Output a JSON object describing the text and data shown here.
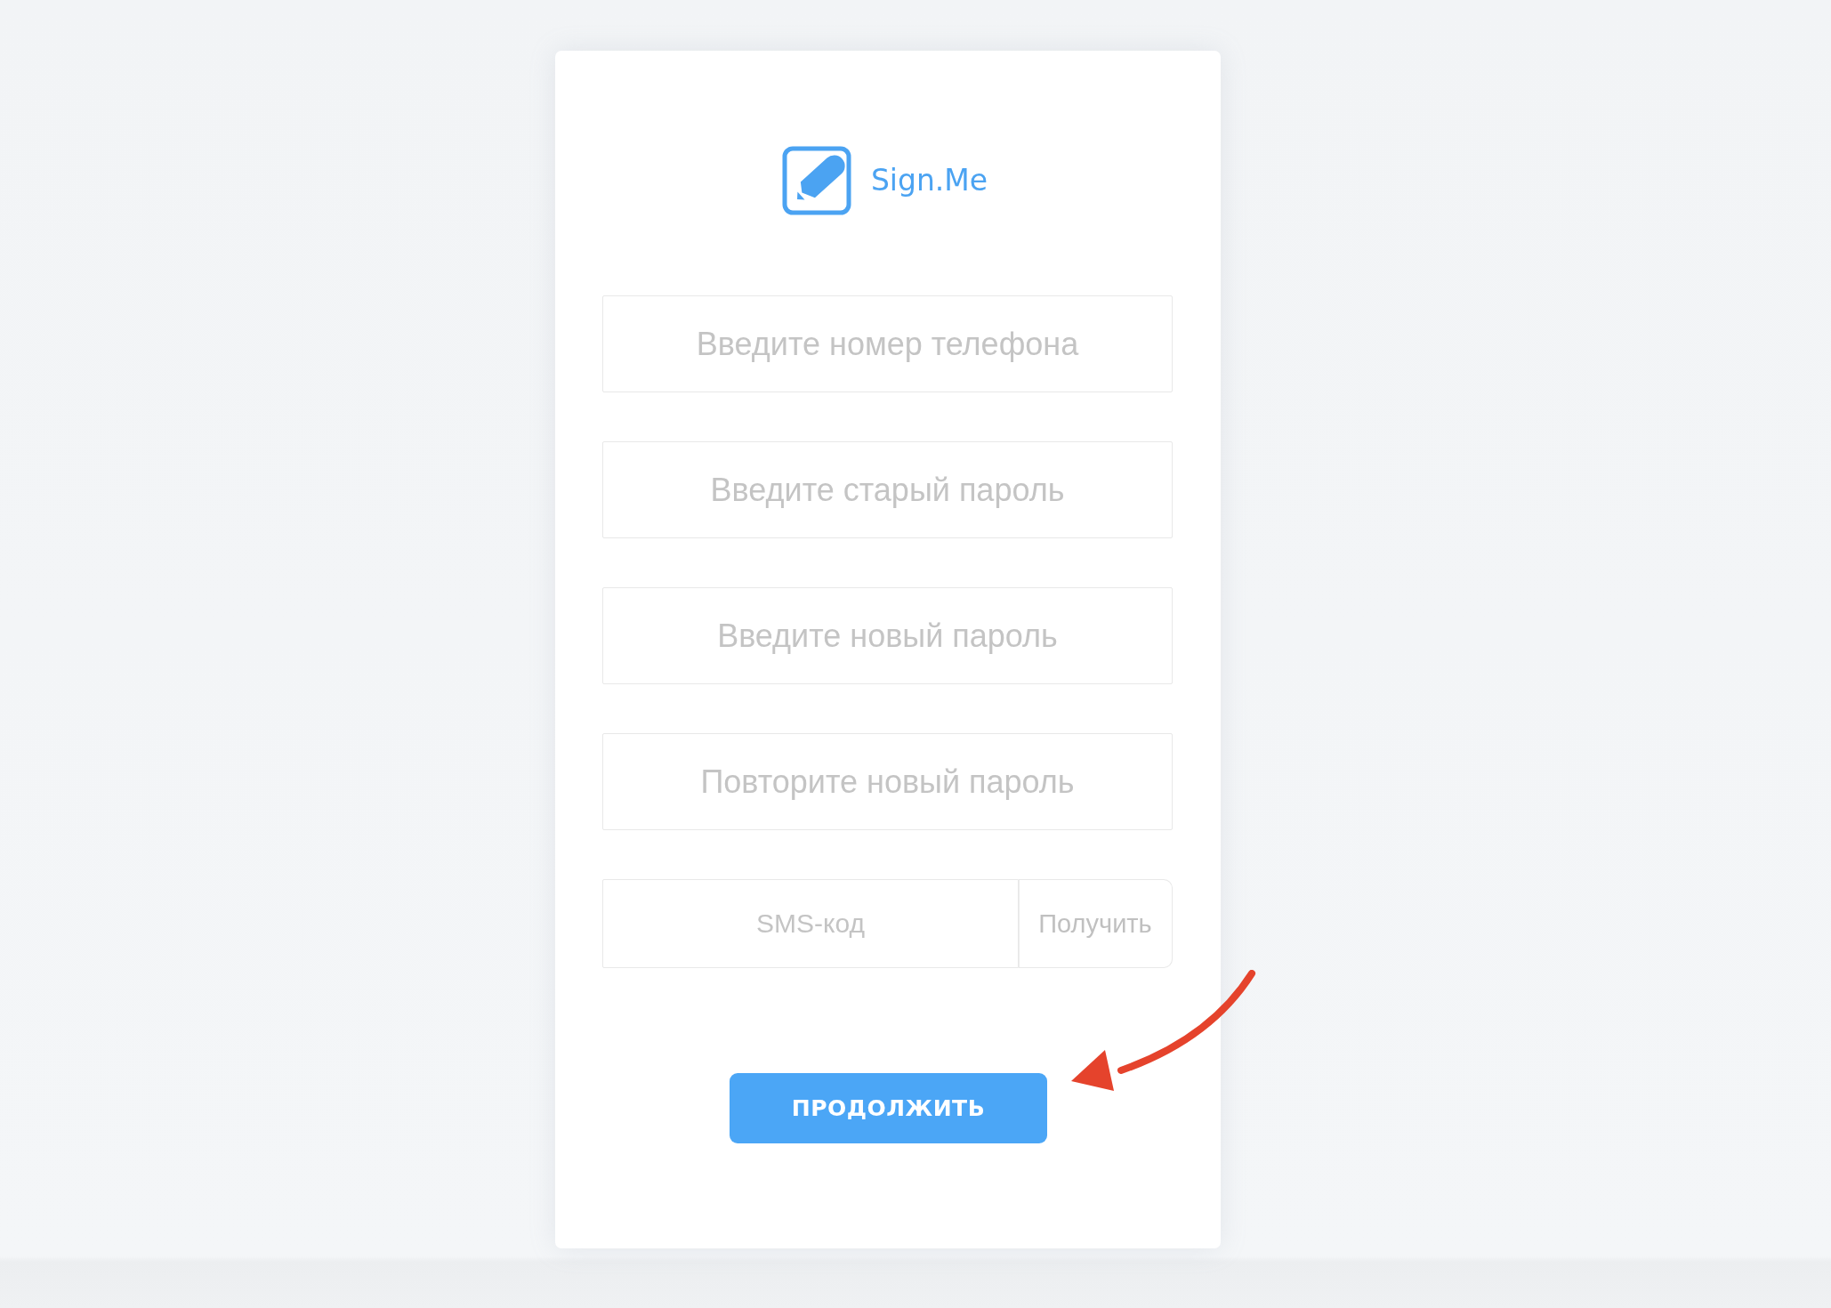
{
  "logo": {
    "name": "Sign.Me"
  },
  "fields": [
    {
      "placeholder": "Введите номер телефона"
    },
    {
      "placeholder": "Введите старый пароль"
    },
    {
      "placeholder": "Введите новый пароль"
    },
    {
      "placeholder": "Повторите новый пароль"
    }
  ],
  "sms": {
    "placeholder": "SMS-код",
    "button": "Получить"
  },
  "submit": {
    "label": "ПРОДОЛЖИТЬ"
  }
}
